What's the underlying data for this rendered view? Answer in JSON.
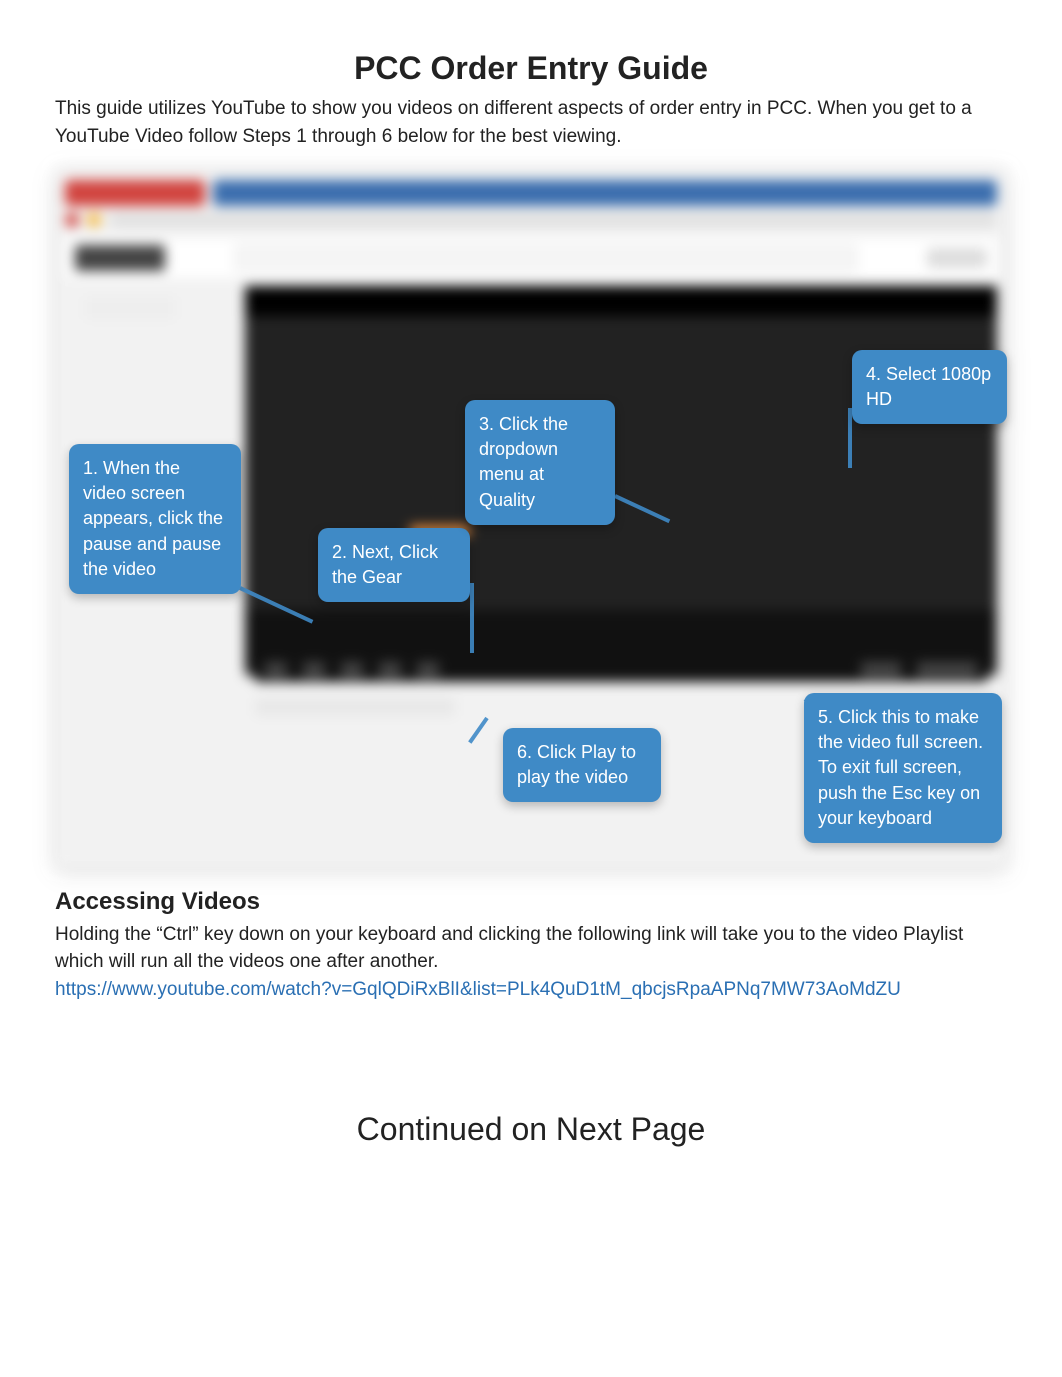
{
  "title": "PCC Order Entry Guide",
  "intro": "This guide utilizes YouTube to show you videos on different aspects of order entry in PCC. When you get to a YouTube Video follow Steps 1 through 6 below for the best viewing.",
  "callouts": {
    "c1": "1. When the video screen appears, click the pause and pause the video",
    "c2": "2. Next, Click the Gear",
    "c3": "3. Click the dropdown menu at Quality",
    "c4": "4. Select 1080p HD",
    "c5": "5. Click this to make the video full screen.  To exit full screen, push the Esc key on your keyboard",
    "c6": "6. Click Play to play the video"
  },
  "section_heading": "Accessing Videos",
  "section_body": "Holding the “Ctrl” key down on your keyboard and clicking the following link will take you to the video Playlist which will run all the videos one after another.",
  "link_text": "https://www.youtube.com/watch?v=GqlQDiRxBlI&list=PLk4QuD1tM_qbcjsRpaAPNq7MW73AoMdZU",
  "continued": "Continued on Next Page"
}
